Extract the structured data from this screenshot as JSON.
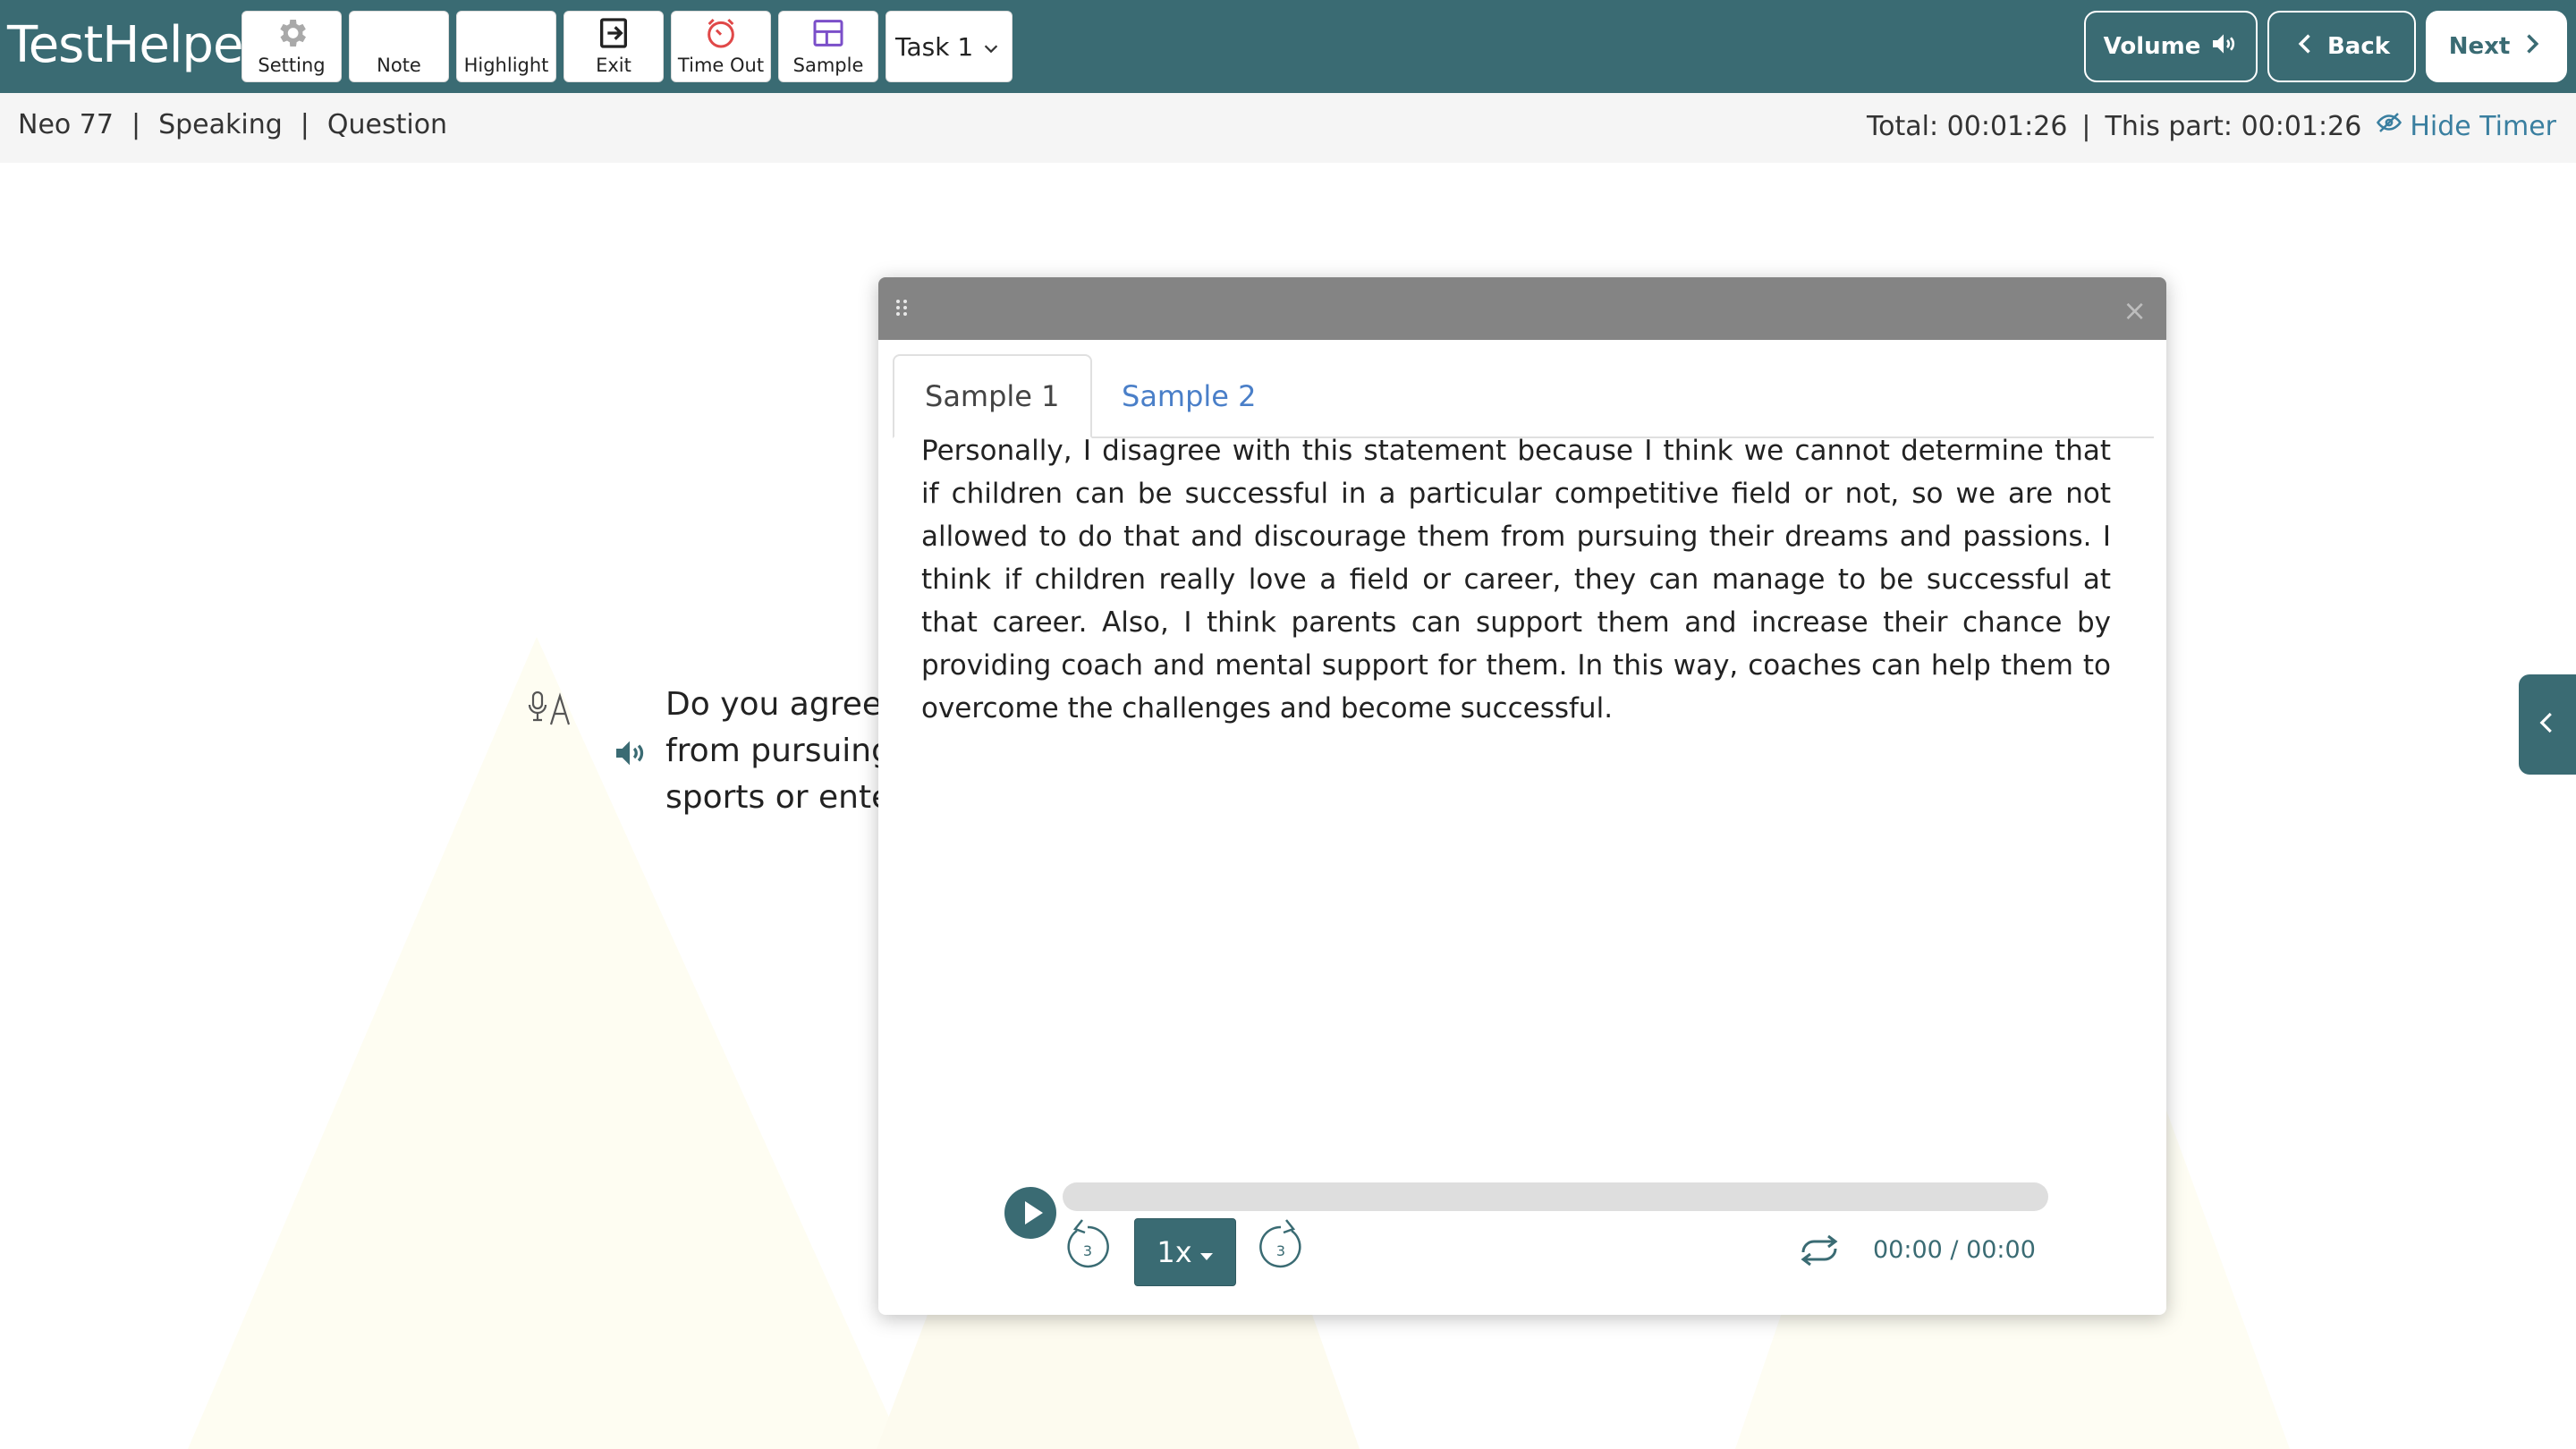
{
  "app": {
    "title": "TestHelper"
  },
  "toolbar": {
    "buttons": [
      {
        "label": "Setting",
        "icon": "gear-icon"
      },
      {
        "label": "Note",
        "icon": ""
      },
      {
        "label": "Highlight",
        "icon": ""
      },
      {
        "label": "Exit",
        "icon": "exit-icon"
      },
      {
        "label": "Time Out",
        "icon": "timer-icon"
      },
      {
        "label": "Sample",
        "icon": "layout-icon"
      }
    ],
    "task_select": {
      "value": "Task 1"
    },
    "volume": {
      "label": "Volume",
      "icon": "speaker-icon"
    },
    "back": {
      "label": "Back",
      "icon": "chevron-left-icon"
    },
    "next": {
      "label": "Next",
      "icon": "chevron-right-icon"
    }
  },
  "breadcrumb": {
    "items": [
      "Neo 77",
      "Speaking",
      "Question"
    ],
    "separator": "|"
  },
  "timer": {
    "total_label": "Total:",
    "total_value": "00:01:26",
    "separator": "|",
    "part_label": "This part:",
    "part_value": "00:01:26",
    "hide_label": "Hide Timer"
  },
  "question": {
    "lines": [
      "Do you agree o",
      "from  pursuing",
      "sports or enter"
    ]
  },
  "modal": {
    "tabs": [
      "Sample 1",
      "Sample 2"
    ],
    "active_tab": 0,
    "close_symbol": "×",
    "sample_text": "Personally, I disagree with this statement because I think we cannot determine that if children can be successful in a particular competitive field or not, so we are not allowed to do that and discourage them from pursuing their dreams and passions. I think if children really love a field or career, they can manage to be successful at that career. Also, I think parents can support them and increase their chance by providing coach and mental support for them. In this way, coaches can help them to overcome the challenges and become successful."
  },
  "player": {
    "progress": 0,
    "speed": "1x",
    "rewind_seconds": "3",
    "forward_seconds": "3",
    "time": "00:00 / 00:00"
  },
  "colors": {
    "primary": "#3a6b73",
    "accent_blue": "#4a7fc8",
    "timeout_red": "#e04848",
    "sample_purple": "#7b4fc9",
    "modal_header": "#848484"
  }
}
